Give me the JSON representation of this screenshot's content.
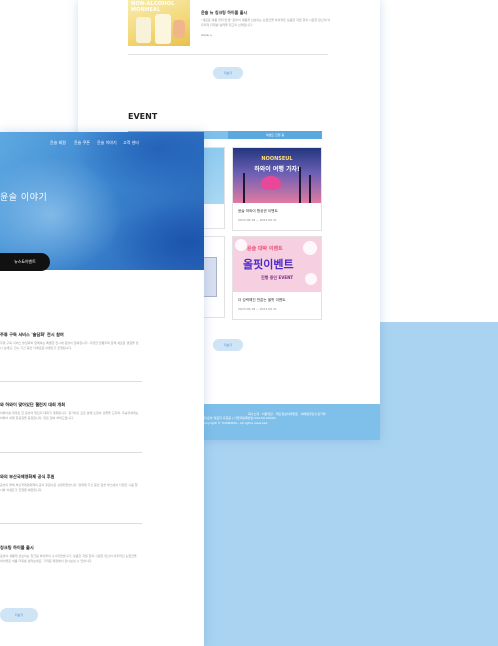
{
  "colors": {
    "accent": "#7fc0ea",
    "hero": "#3c86cf",
    "button_dark": "#111111",
    "pill_bg": "#cfe5f6"
  },
  "back": {
    "food": {
      "thumb_text": "NON-ALCOHOL MONHEAL",
      "title": "윤슬 뉴 칭크팅 하이볼 출시",
      "desc": "\"새로운 여름 맛의 탄생\"\n윤슬이 새롭게 선보이는 논알코올 하이볼은 상큼한 과일 향과 시원한 탄산이 어우러져 더위를 날려줄 최고의 선택입니다.",
      "more": "more +"
    },
    "more_button": "더보기",
    "event_section_title": "EVENT",
    "event_tab": "이벤트 진행 중",
    "events": [
      {
        "img_line1": "NOONSEUL",
        "img_line2": "하와이 여행 가자!",
        "name": "윤슬 하와이 항공권 이벤트",
        "date": "2023.06.18 ~ 2023.06.31"
      },
      {
        "img_line1": "윤슬 대박 이벤트",
        "img_line2": "올핏이벤트",
        "img_line3": "진행 중인 EVENT",
        "name": "더 강력해진 반값는 올핏 이벤트",
        "date": "2023.06.18 ~ 2023.06.31"
      }
    ],
    "more_button2": "더보기",
    "footer_lines": [
      "회사소개 · 이용약관 · 개인정보처리방침 · 이메일무단수집거부",
      "(주)윤슬 대표자 홍길동 | 사업자등록번호 000-00-00000",
      "Copyright © YOONSEUL. All rights reserved."
    ]
  },
  "front": {
    "nav": [
      "윤슬 회원",
      "윤슬 쿠폰",
      "윤슬 이야기",
      "고객 센터"
    ],
    "hero_title": "윤슬 이야기",
    "hero_button": "뉴스&이벤트",
    "news": [
      {
        "title": "주류 구독 서비스 '술담화' 전시 참여",
        "body": "주류 구독 서비스 술담화와 함께하는 특별한 전시에 윤슬이 참여합니다. 다양한 전통주와 함께 새로운 경험을 만나 보세요. 전시 기간 동안 다채로운 이벤트가 진행됩니다."
      },
      {
        "title": "와 하와이 맞아있단 챌린지 대회 개최",
        "body": "하와이를 테마로 한 윤슬의 챌린지 대회가 개최됩니다. 참가하신 모든 분께 소정의 선물을 드리며, 우승자에게는 하와이 여행 항공권을 증정합니다. 많은 참여 부탁드립니다."
      },
      {
        "title": "와의 부산국제영화제 공식 후원",
        "body": "윤슬이 올해 부산국제영화제의 공식 후원사로 선정되었습니다. 영화제 기간 동안 윤슬 부스에서 다양한 시음 행사와 이벤트가 진행될 예정입니다."
      },
      {
        "title": "칭크팅 하이볼 출시",
        "body": "윤슬이 새롭게 선보이는 칭크팅 하이볼이 출시되었습니다. 상큼한 과일 향과 시원한 탄산이 어우러진 논알코올 하이볼로 여름 더위를 날려보세요. 가까운 매장에서 만나보실 수 있습니다."
      }
    ],
    "more_button": "더보기"
  }
}
